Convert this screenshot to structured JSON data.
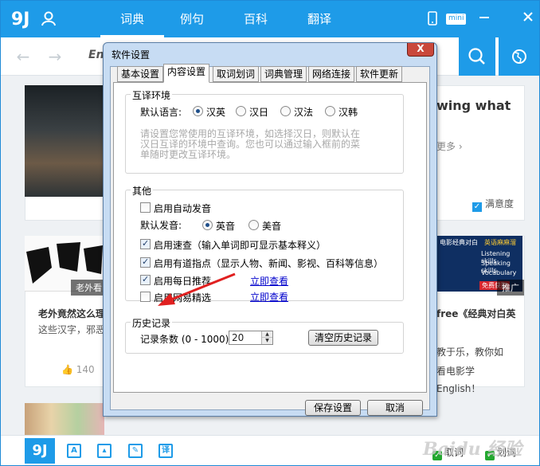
{
  "app": {
    "nav_tabs": [
      "词典",
      "例句",
      "百科",
      "翻译"
    ],
    "mini_label": "mini",
    "search_text": "En",
    "left_cards": [
      {
        "caption": "老外看",
        "title": "老外竟然这么理",
        "text": "这些汉字，邪恶",
        "likes": "140"
      }
    ],
    "right_panel": {
      "title": "wing what",
      "more": "更多 ›",
      "satisfaction": "满意度",
      "ad_caption": "推广",
      "ad_lines": [
        "电影经典对白",
        "英语麻麻溜",
        "Listening skills",
        "Speaking skills",
        "Vocabulary",
        "免费获取"
      ],
      "lines": [
        "free《经典对白英",
        "教于乐，教你如",
        "看电影学",
        "English！"
      ]
    },
    "bottom": {
      "logo": "9J",
      "check1": "取词",
      "check2": "划词",
      "watermark": "Baidu 经验"
    },
    "colors": {
      "accent": "#1e9be8",
      "dialog_frame": "#c7dcf3",
      "close": "#c9483b"
    }
  },
  "dialog": {
    "title": "软件设置",
    "close_symbol": "X",
    "tabs": [
      "基本设置",
      "内容设置",
      "取词划词",
      "词典管理",
      "网络连接",
      "软件更新"
    ],
    "active_tab": "内容设置",
    "mutual": {
      "legend": "互译环境",
      "default_lang_label": "默认语言:",
      "options": [
        "汉英",
        "汉日",
        "汉法",
        "汉韩"
      ],
      "selected": "汉英",
      "hint_lines": [
        "请设置您常使用的互译环境，如选择汉日，则默认在",
        "汉日互译的环境中查询。您也可以通过输入框前的菜",
        "单随时更改互译环境。"
      ]
    },
    "other": {
      "legend": "其他",
      "auto_pron": {
        "label": "启用自动发音",
        "checked": false
      },
      "default_pron_label": "默认发音:",
      "pron_options": [
        "英音",
        "美音"
      ],
      "pron_selected": "英音",
      "quick": {
        "label": "启用速查（输入单词即可显示基本释义）",
        "checked": true
      },
      "youdao_point": {
        "label": "启用有道指点（显示人物、新闻、影视、百科等信息）",
        "checked": true
      },
      "daily": {
        "label": "启用每日推荐",
        "checked": true,
        "link": "立即查看"
      },
      "netease": {
        "label": "启用网易精选",
        "checked": false,
        "link": "立即查看"
      }
    },
    "history": {
      "legend": "历史记录",
      "count_label": "记录条数 (0 - 1000)",
      "count_value": "20",
      "clear_button": "清空历史记录"
    },
    "save_button": "保存设置",
    "cancel_button": "取消"
  }
}
